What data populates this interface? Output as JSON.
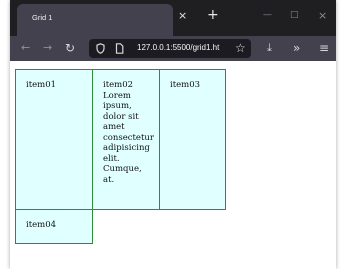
{
  "tab": {
    "title": "Grid 1"
  },
  "window": {
    "new_tab": "+"
  },
  "address_bar": {
    "url": "127.0.0.1:5500/grid1.ht"
  },
  "page": {
    "items": [
      {
        "text": "item01"
      },
      {
        "text": "item02 Lorem ipsum, dolor sit amet consectetur adipisicing elit. Cumque, at."
      },
      {
        "text": "item03"
      },
      {
        "text": "item04"
      }
    ]
  },
  "icons": {
    "close_tab": "×",
    "minimize": "—",
    "maximize": "□",
    "close_window": "×",
    "back": "←",
    "forward": "→",
    "reload": "↻",
    "shield": "shield-icon",
    "page": "page-icon",
    "bookmark": "☆",
    "download": "⤓",
    "overflow": "»",
    "menu": "≡"
  },
  "colors": {
    "cell_bg": "#e0ffff",
    "cell_border": "#2e8b3a",
    "toolbar": "#42414d",
    "tabstrip": "#1f1f22"
  }
}
